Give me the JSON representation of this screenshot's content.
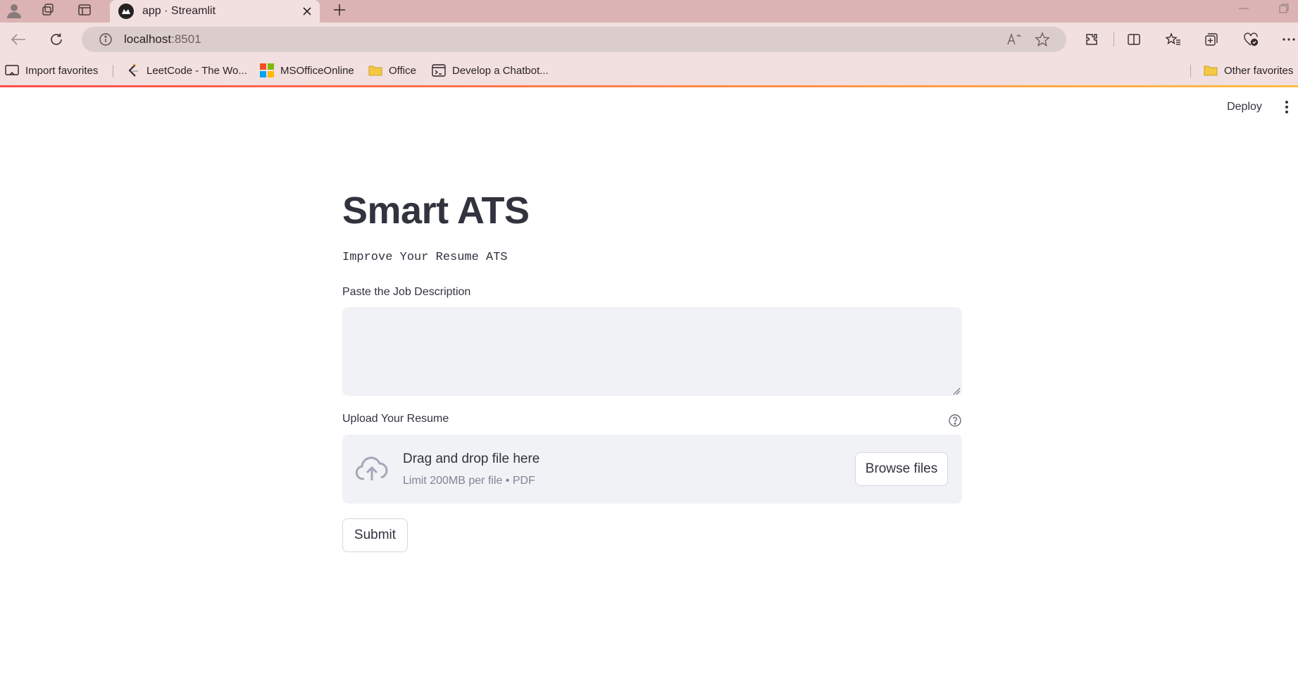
{
  "browser": {
    "tab_title": "app · Streamlit",
    "url_host": "localhost",
    "url_port": ":8501",
    "bookmarks": [
      {
        "label": "Import favorites",
        "icon": "import-icon"
      },
      {
        "label": "LeetCode - The Wo...",
        "icon": "leetcode-icon"
      },
      {
        "label": "MSOfficeOnline",
        "icon": "microsoft-icon"
      },
      {
        "label": "Office",
        "icon": "folder-icon"
      },
      {
        "label": "Develop a Chatbot...",
        "icon": "terminal-icon"
      }
    ],
    "other_favorites": "Other favorites"
  },
  "header": {
    "deploy_label": "Deploy"
  },
  "main": {
    "title": "Smart ATS",
    "subtitle": "Improve Your Resume ATS",
    "jd_label": "Paste the Job Description",
    "jd_value": "",
    "upload_label": "Upload Your Resume",
    "drop_title": "Drag and drop file here",
    "drop_limit": "Limit 200MB per file • PDF",
    "browse_label": "Browse files",
    "submit_label": "Submit"
  },
  "colors": {
    "tabbar": "#dcb3b4",
    "chrome": "#f2e0e0",
    "text": "#31333f",
    "widget_bg": "#f0f2f6",
    "accent_gradient_start": "#ff4b4b",
    "accent_gradient_end": "#ffbd45"
  }
}
